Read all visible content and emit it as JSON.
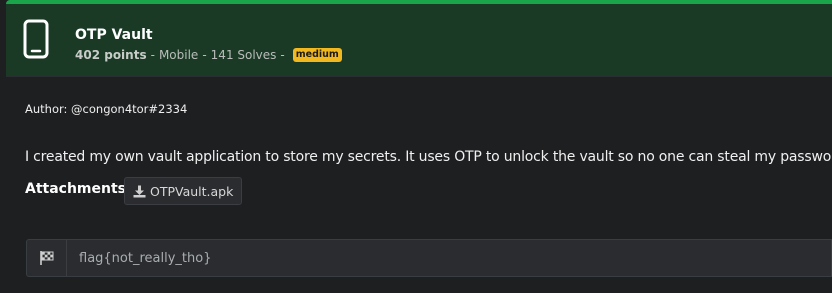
{
  "challenge": {
    "title": "OTP Vault",
    "points": "402 points",
    "category": "Mobile",
    "solves": "141 Solves",
    "separator": "-",
    "difficulty": "medium",
    "icon": "smartphone-icon"
  },
  "body": {
    "author": "Author: @congon4tor#2334",
    "description": "I created my own vault application to store my secrets. It uses OTP to unlock the vault so no one can steal my password!",
    "attachments_label": "Attachments:",
    "attachment_file": "OTPVault.apk",
    "attachment_icon": "download-icon"
  },
  "flag": {
    "placeholder": "flag{not_really_tho}",
    "value": "",
    "icon": "checkered-flag-icon"
  },
  "colors": {
    "accent": "#1aa54a",
    "header_bg": "#1b3a26",
    "badge": "#f2b820",
    "page_bg": "#1e1f21"
  }
}
